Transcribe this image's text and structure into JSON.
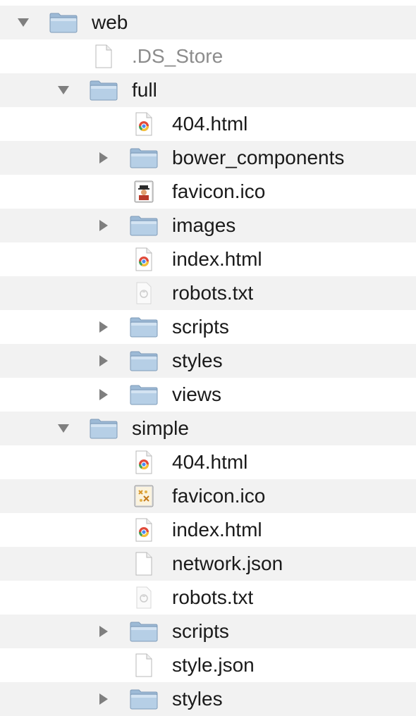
{
  "tree": [
    {
      "name": "web",
      "kind": "folder",
      "depth": 0,
      "expanded": true,
      "icon": "folder-icon"
    },
    {
      "name": ".DS_Store",
      "kind": "file",
      "depth": 1,
      "icon": "blank-document-icon",
      "dim": true
    },
    {
      "name": "full",
      "kind": "folder",
      "depth": 1,
      "expanded": true,
      "icon": "folder-icon"
    },
    {
      "name": "404.html",
      "kind": "file",
      "depth": 2,
      "icon": "html-document-icon"
    },
    {
      "name": "bower_components",
      "kind": "folder",
      "depth": 2,
      "expanded": false,
      "icon": "folder-icon"
    },
    {
      "name": "favicon.ico",
      "kind": "file",
      "depth": 2,
      "icon": "favicon-image-icon"
    },
    {
      "name": "images",
      "kind": "folder",
      "depth": 2,
      "expanded": false,
      "icon": "folder-icon"
    },
    {
      "name": "index.html",
      "kind": "file",
      "depth": 2,
      "icon": "html-document-icon"
    },
    {
      "name": "robots.txt",
      "kind": "file",
      "depth": 2,
      "icon": "text-document-icon"
    },
    {
      "name": "scripts",
      "kind": "folder",
      "depth": 2,
      "expanded": false,
      "icon": "folder-icon"
    },
    {
      "name": "styles",
      "kind": "folder",
      "depth": 2,
      "expanded": false,
      "icon": "folder-icon"
    },
    {
      "name": "views",
      "kind": "folder",
      "depth": 2,
      "expanded": false,
      "icon": "folder-icon"
    },
    {
      "name": "simple",
      "kind": "folder",
      "depth": 1,
      "expanded": true,
      "icon": "folder-icon"
    },
    {
      "name": "404.html",
      "kind": "file",
      "depth": 2,
      "icon": "html-document-icon"
    },
    {
      "name": "favicon.ico",
      "kind": "file",
      "depth": 2,
      "icon": "favicon-preview-icon"
    },
    {
      "name": "index.html",
      "kind": "file",
      "depth": 2,
      "icon": "html-document-icon"
    },
    {
      "name": "network.json",
      "kind": "file",
      "depth": 2,
      "icon": "blank-document-icon"
    },
    {
      "name": "robots.txt",
      "kind": "file",
      "depth": 2,
      "icon": "text-document-icon"
    },
    {
      "name": "scripts",
      "kind": "folder",
      "depth": 2,
      "expanded": false,
      "icon": "folder-icon"
    },
    {
      "name": "style.json",
      "kind": "file",
      "depth": 2,
      "icon": "blank-document-icon"
    },
    {
      "name": "styles",
      "kind": "folder",
      "depth": 2,
      "expanded": false,
      "icon": "folder-icon"
    }
  ],
  "colors": {
    "row_stripe": "#f2f2f2",
    "folder_fill": "#b6cfe6",
    "folder_tab": "#9dbad6",
    "disclosure_triangle": "#7f7f7f",
    "text": "#1a1a1a",
    "text_dim": "#8c8c8c"
  }
}
